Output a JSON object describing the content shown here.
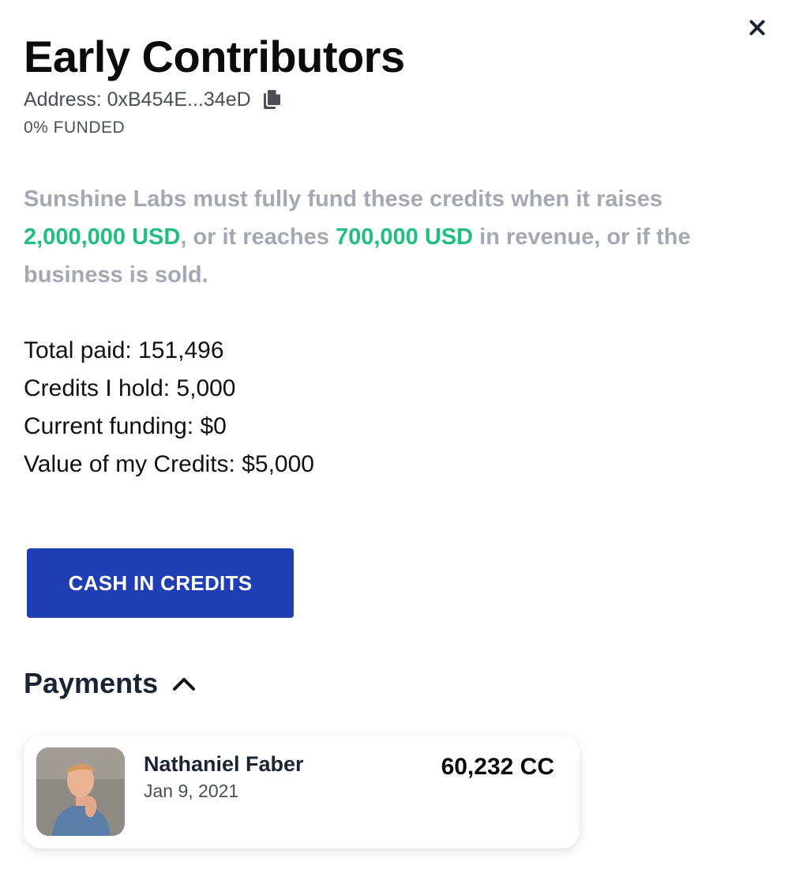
{
  "header": {
    "title": "Early Contributors",
    "address_label": "Address: 0xB454E...34eD",
    "funded_status": "0% FUNDED",
    "close_icon": "close-icon",
    "copy_icon": "copy-icon"
  },
  "description": {
    "part1": "Sunshine Labs must fully fund these credits when it raises ",
    "raise_amount": "2,000,000 USD",
    "part2": ", or it reaches ",
    "revenue_amount": "700,000 USD",
    "part3": " in revenue, or if the business is sold.",
    "highlight_color": "#1fbf7f"
  },
  "stats": {
    "total_paid": "Total paid: 151,496",
    "credits_held": "Credits I hold: 5,000",
    "current_funding": "Current funding: $0",
    "credits_value": "Value of my Credits: $5,000"
  },
  "actions": {
    "cash_in_label": "CASH IN CREDITS",
    "button_color": "#1f3eb3"
  },
  "payments": {
    "title": "Payments",
    "toggle_icon": "chevron-up-icon",
    "items": [
      {
        "name": "Nathaniel Faber",
        "date": "Jan 9, 2021",
        "amount": "60,232 CC",
        "avatar": "avatar-photo"
      }
    ]
  }
}
